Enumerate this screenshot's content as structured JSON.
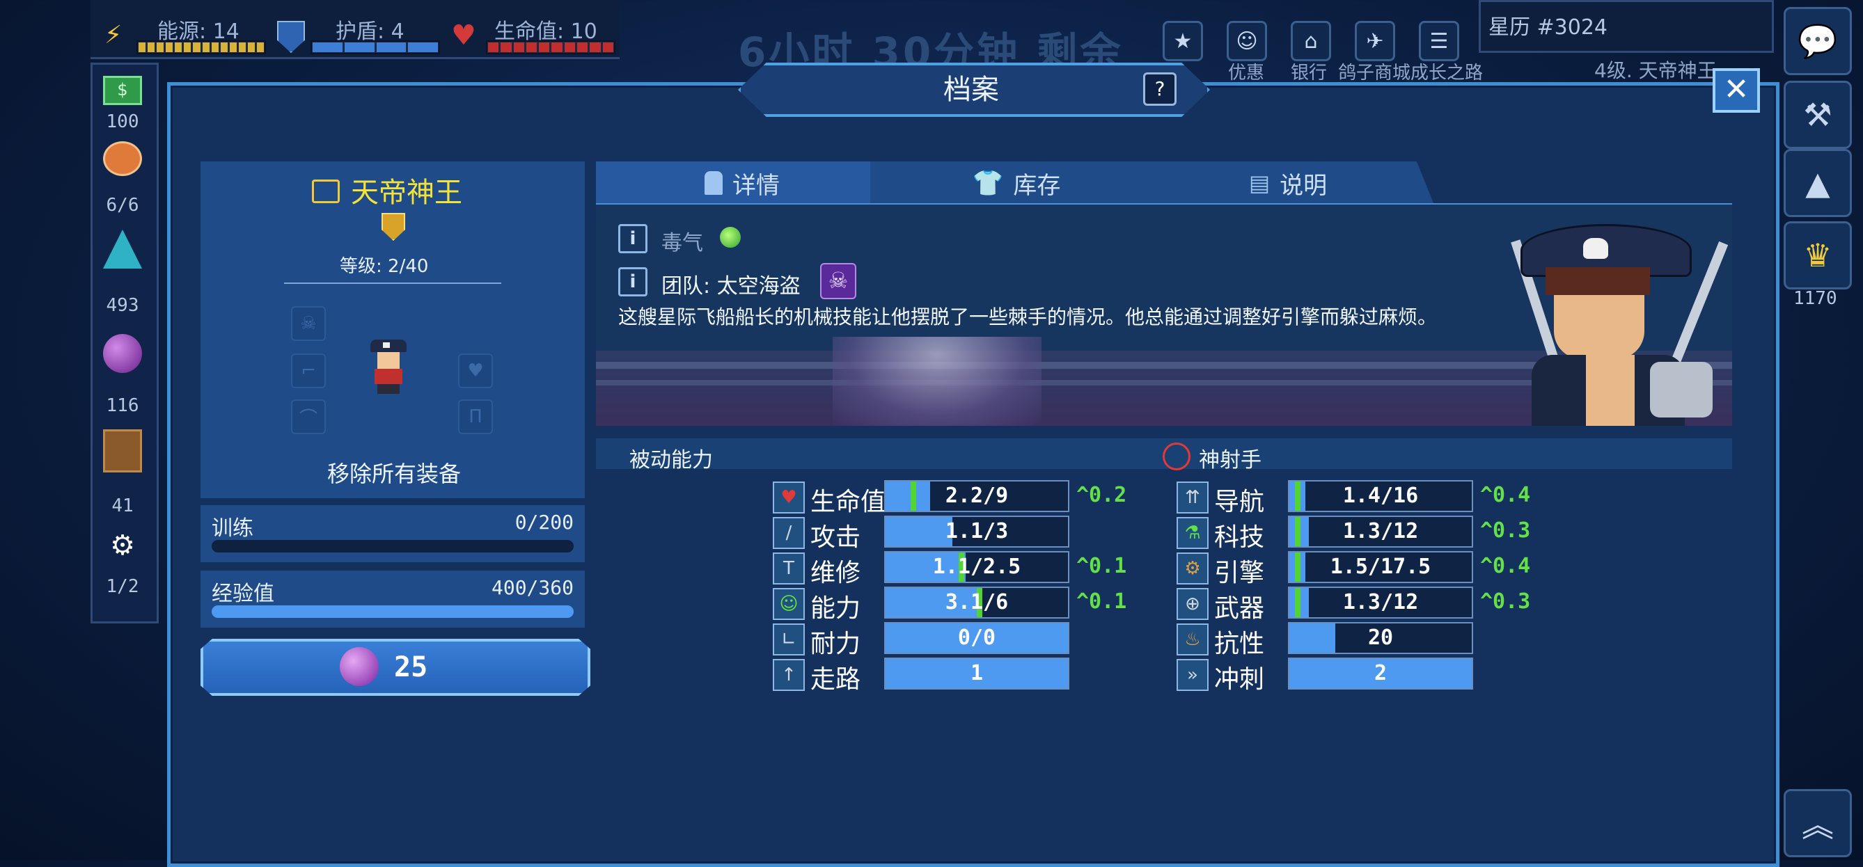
{
  "hud": {
    "energy": "能源: 14",
    "shield": "护盾: 4",
    "hp": "生命值: 10",
    "countdown_faint": "6小时 30分钟 剩余",
    "stardate": "星历 #3024",
    "level_line": "4级. 天帝神王"
  },
  "top_menu": [
    {
      "icon": "star-badge-icon",
      "label": ""
    },
    {
      "icon": "discount-icon",
      "label": "优惠"
    },
    {
      "icon": "bank-icon",
      "label": "银行"
    },
    {
      "icon": "pigeon-icon",
      "label": "鸽子商城"
    },
    {
      "icon": "document-icon",
      "label": "成长之路"
    }
  ],
  "left_resources": [
    {
      "value": "100",
      "icon": "cash-icon"
    },
    {
      "value": "6/6",
      "icon": "crew-icon"
    },
    {
      "value": "493",
      "icon": "crystal-icon"
    },
    {
      "value": "116",
      "icon": "orb-icon"
    },
    {
      "value": "41",
      "icon": "crate-icon"
    },
    {
      "value": "1/2",
      "icon": "drone-icon"
    }
  ],
  "right_side": {
    "trophy_count": "1170"
  },
  "panel": {
    "title": "档案",
    "help": "?",
    "close": "✕"
  },
  "character": {
    "name": "天帝神王",
    "level": "等级: 2/40",
    "remove_all": "移除所有装备"
  },
  "training": {
    "label": "训练",
    "value": "0/200",
    "progress": 0
  },
  "experience": {
    "label": "经验值",
    "value": "400/360",
    "progress": 1.0
  },
  "orb_button": {
    "value": "25"
  },
  "tabs": [
    {
      "label": "详情",
      "icon": "profile-icon"
    },
    {
      "label": "库存",
      "icon": "shirt-icon"
    },
    {
      "label": "说明",
      "icon": "notes-icon"
    }
  ],
  "details": {
    "trait1": "毒气",
    "team": "团队: 太空海盗",
    "description": "这艘星际飞船船长的机械技能让他摆脱了一些棘手的情况。他总能通过调整好引擎而躲过麻烦。"
  },
  "passive": {
    "label": "被动能力",
    "specialty": "神射手"
  },
  "stats_left": [
    {
      "name": "生命值",
      "value": "2.2/9",
      "fill": 0.244,
      "mark": 0.138,
      "bonus": "^0.2",
      "icon": "heart-icon"
    },
    {
      "name": "攻击",
      "value": "1.1/3",
      "fill": 0.367,
      "mark": null,
      "bonus": "",
      "icon": "sword-icon"
    },
    {
      "name": "维修",
      "value": "1.1/2.5",
      "fill": 0.44,
      "mark": 0.4,
      "bonus": "^0.1",
      "icon": "hammer-icon"
    },
    {
      "name": "能力",
      "value": "3.1/6",
      "fill": 0.517,
      "mark": 0.5,
      "bonus": "^0.1",
      "icon": "person-icon"
    },
    {
      "name": "耐力",
      "value": "0/0",
      "fill": 1.0,
      "mark": null,
      "bonus": "",
      "icon": "boot-icon"
    },
    {
      "name": "走路",
      "value": "1",
      "fill": 1.0,
      "mark": null,
      "bonus": "",
      "icon": "walk-icon"
    }
  ],
  "stats_right": [
    {
      "name": "导航",
      "value": "1.4/16",
      "fill": 0.088,
      "mark": 0.03,
      "bonus": "^0.4",
      "icon": "navigation-icon"
    },
    {
      "name": "科技",
      "value": "1.3/12",
      "fill": 0.108,
      "mark": 0.03,
      "bonus": "^0.3",
      "icon": "flask-icon"
    },
    {
      "name": "引擎",
      "value": "1.5/17.5",
      "fill": 0.086,
      "mark": 0.03,
      "bonus": "^0.4",
      "icon": "engine-icon"
    },
    {
      "name": "武器",
      "value": "1.3/12",
      "fill": 0.108,
      "mark": 0.03,
      "bonus": "^0.3",
      "icon": "crosshair-icon"
    },
    {
      "name": "抗性",
      "value": "20",
      "fill": 0.25,
      "mark": null,
      "bonus": "",
      "icon": "fire-icon"
    },
    {
      "name": "冲刺",
      "value": "2",
      "fill": 1.0,
      "mark": null,
      "bonus": "",
      "icon": "sprint-icon"
    }
  ]
}
